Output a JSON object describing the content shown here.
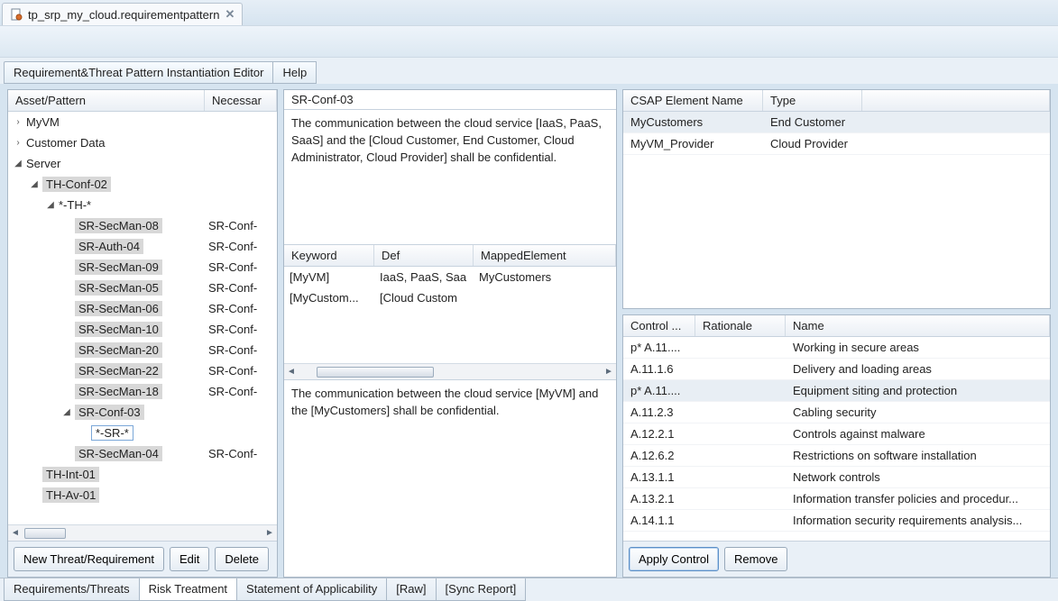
{
  "tab": {
    "title": "tp_srp_my_cloud.requirementpattern"
  },
  "menu": {
    "editor": "Requirement&Threat Pattern Instantiation Editor",
    "help": "Help"
  },
  "tree": {
    "headers": {
      "asset": "Asset/Pattern",
      "necessary": "Necessar"
    },
    "rows": [
      {
        "depth": 0,
        "twisty": "›",
        "label": "MyVM",
        "nec": "",
        "hl": false
      },
      {
        "depth": 0,
        "twisty": "›",
        "label": "Customer Data",
        "nec": "",
        "hl": false
      },
      {
        "depth": 0,
        "twisty": "◢",
        "label": "Server",
        "nec": "",
        "hl": false
      },
      {
        "depth": 1,
        "twisty": "◢",
        "label": "TH-Conf-02",
        "nec": "",
        "hl": true
      },
      {
        "depth": 2,
        "twisty": "◢",
        "label": "*-TH-*",
        "nec": "",
        "hl": false
      },
      {
        "depth": 3,
        "twisty": "",
        "label": "SR-SecMan-08",
        "nec": "SR-Conf-",
        "hl": true
      },
      {
        "depth": 3,
        "twisty": "",
        "label": "SR-Auth-04",
        "nec": "SR-Conf-",
        "hl": true
      },
      {
        "depth": 3,
        "twisty": "",
        "label": "SR-SecMan-09",
        "nec": "SR-Conf-",
        "hl": true
      },
      {
        "depth": 3,
        "twisty": "",
        "label": "SR-SecMan-05",
        "nec": "SR-Conf-",
        "hl": true
      },
      {
        "depth": 3,
        "twisty": "",
        "label": "SR-SecMan-06",
        "nec": "SR-Conf-",
        "hl": true
      },
      {
        "depth": 3,
        "twisty": "",
        "label": "SR-SecMan-10",
        "nec": "SR-Conf-",
        "hl": true
      },
      {
        "depth": 3,
        "twisty": "",
        "label": "SR-SecMan-20",
        "nec": "SR-Conf-",
        "hl": true
      },
      {
        "depth": 3,
        "twisty": "",
        "label": "SR-SecMan-22",
        "nec": "SR-Conf-",
        "hl": true
      },
      {
        "depth": 3,
        "twisty": "",
        "label": "SR-SecMan-18",
        "nec": "SR-Conf-",
        "hl": true
      },
      {
        "depth": 3,
        "twisty": "◢",
        "label": "SR-Conf-03",
        "nec": "",
        "hl": true
      },
      {
        "depth": 4,
        "twisty": "",
        "label": "*-SR-*",
        "nec": "",
        "sel": true
      },
      {
        "depth": 3,
        "twisty": "",
        "label": "SR-SecMan-04",
        "nec": "SR-Conf-",
        "hl": true
      },
      {
        "depth": 1,
        "twisty": "",
        "label": "TH-Int-01",
        "nec": "",
        "hl": true
      },
      {
        "depth": 1,
        "twisty": "",
        "label": "TH-Av-01",
        "nec": "",
        "hl": true
      }
    ]
  },
  "buttons": {
    "new": "New Threat/Requirement",
    "edit": "Edit",
    "delete": "Delete",
    "apply": "Apply Control",
    "remove": "Remove"
  },
  "detail": {
    "title": "SR-Conf-03",
    "desc": "The communication between the cloud service [IaaS, PaaS, SaaS] and the [Cloud Customer, End Customer, Cloud Administrator, Cloud Provider] shall be confidential.",
    "instantiated": "The communication between the cloud service [MyVM] and the [MyCustomers] shall be confidential."
  },
  "kw": {
    "headers": {
      "keyword": "Keyword",
      "def": "Def",
      "mapped": "MappedElement"
    },
    "rows": [
      {
        "keyword": "[MyVM]",
        "def": "IaaS, PaaS, Saa",
        "mapped": "MyCustomers"
      },
      {
        "keyword": "[MyCustom...",
        "def": "[Cloud Custom",
        "mapped": ""
      }
    ]
  },
  "csap": {
    "headers": {
      "name": "CSAP Element Name",
      "type": "Type"
    },
    "rows": [
      {
        "name": "MyCustomers",
        "type": "End Customer",
        "sel": true
      },
      {
        "name": "MyVM_Provider",
        "type": "Cloud Provider"
      }
    ]
  },
  "controls": {
    "headers": {
      "control": "Control ...",
      "rationale": "Rationale",
      "name": "Name"
    },
    "rows": [
      {
        "control": "p* A.11....",
        "rationale": "",
        "name": "Working in secure areas"
      },
      {
        "control": "A.11.1.6",
        "rationale": "",
        "name": "Delivery and loading areas"
      },
      {
        "control": "p* A.11....",
        "rationale": "",
        "name": "Equipment siting and protection",
        "sel": true
      },
      {
        "control": "A.11.2.3",
        "rationale": "",
        "name": "Cabling security"
      },
      {
        "control": "A.12.2.1",
        "rationale": "",
        "name": "Controls against malware"
      },
      {
        "control": "A.12.6.2",
        "rationale": "",
        "name": "Restrictions on software installation"
      },
      {
        "control": "A.13.1.1",
        "rationale": "",
        "name": "Network controls"
      },
      {
        "control": "A.13.2.1",
        "rationale": "",
        "name": "Information transfer policies and procedur..."
      },
      {
        "control": "A.14.1.1",
        "rationale": "",
        "name": "Information security requirements analysis..."
      }
    ]
  },
  "bottomTabs": {
    "t0": "Requirements/Threats",
    "t1": "Risk Treatment",
    "t2": "Statement of Applicability",
    "t3": "[Raw]",
    "t4": "[Sync Report]"
  }
}
